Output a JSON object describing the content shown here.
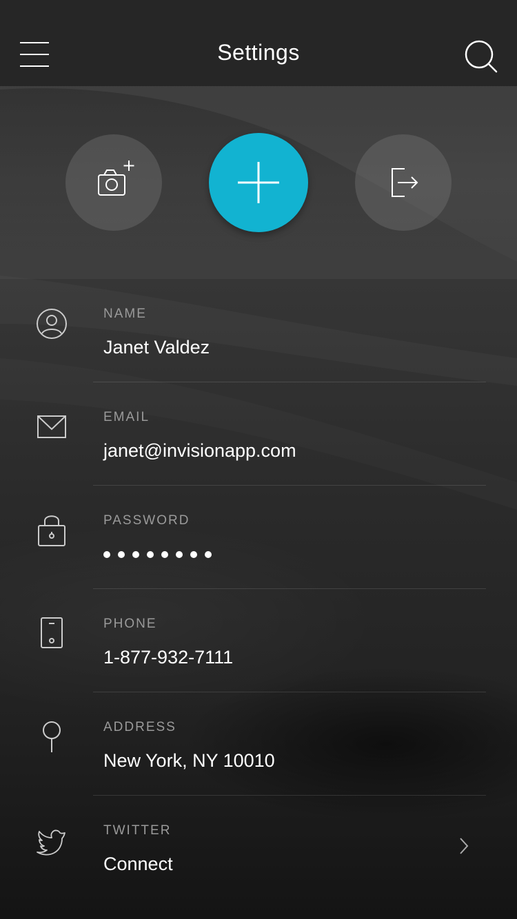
{
  "header": {
    "title": "Settings"
  },
  "actions": {
    "camera_icon": "camera-add-icon",
    "add_icon": "plus-icon",
    "logout_icon": "logout-icon",
    "accent_color": "#12b3d1"
  },
  "fields": [
    {
      "label": "NAME",
      "value": "Janet Valdez",
      "icon": "user-icon"
    },
    {
      "label": "EMAIL",
      "value": "janet@invisionapp.com",
      "icon": "mail-icon"
    },
    {
      "label": "PASSWORD",
      "value": "••••••••",
      "icon": "lock-icon"
    },
    {
      "label": "PHONE",
      "value": "1-877-932-7111",
      "icon": "phone-icon"
    },
    {
      "label": "ADDRESS",
      "value": "New York, NY 10010",
      "icon": "location-pin-icon"
    },
    {
      "label": "TWITTER",
      "value": "Connect",
      "icon": "twitter-icon"
    }
  ]
}
